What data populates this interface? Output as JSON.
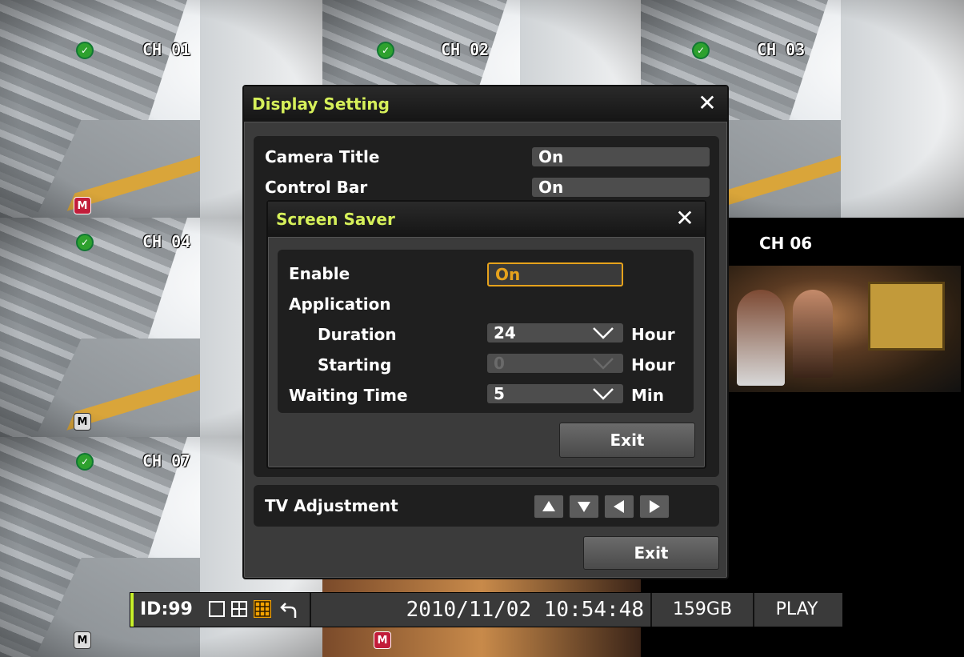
{
  "channels": [
    {
      "label": "CH 01",
      "status_icon": "v-check-icon",
      "badge": "M",
      "badge_color": "#c21d3a"
    },
    {
      "label": "CH 02",
      "status_icon": "v-check-icon"
    },
    {
      "label": "CH 03",
      "status_icon": "v-check-icon"
    },
    {
      "label": "CH 04",
      "status_icon": "v-check-icon",
      "badge": "M",
      "badge_color": "#dddddd"
    },
    {
      "label": "CH 06"
    },
    {
      "label": "CH 07",
      "status_icon": "v-check-icon",
      "badge": "M",
      "badge_color": "#dddddd"
    },
    {
      "badge": "M",
      "badge_color": "#c21d3a"
    }
  ],
  "display_setting": {
    "title": "Display Setting",
    "rows": [
      {
        "label": "Camera Title",
        "value": "On"
      },
      {
        "label": "Control Bar",
        "value": "On"
      }
    ],
    "tv_adjustment_label": "TV Adjustment",
    "exit_label": "Exit"
  },
  "screen_saver": {
    "title": "Screen Saver",
    "enable_label": "Enable",
    "enable_value": "On",
    "application_label": "Application",
    "duration_label": "Duration",
    "duration_value": "24",
    "duration_unit": "Hour",
    "starting_label": "Starting",
    "starting_value": "0",
    "starting_unit": "Hour",
    "waiting_label": "Waiting Time",
    "waiting_value": "5",
    "waiting_unit": "Min",
    "exit_label": "Exit"
  },
  "status_bar": {
    "id": "ID:99",
    "datetime": "2010/11/02 10:54:48",
    "storage": "159GB",
    "mode": "PLAY"
  },
  "colors": {
    "title_text": "#d6f05a",
    "active_border": "#e6a21c",
    "ok_green": "#2ea12e",
    "record_red": "#c21d3a"
  }
}
